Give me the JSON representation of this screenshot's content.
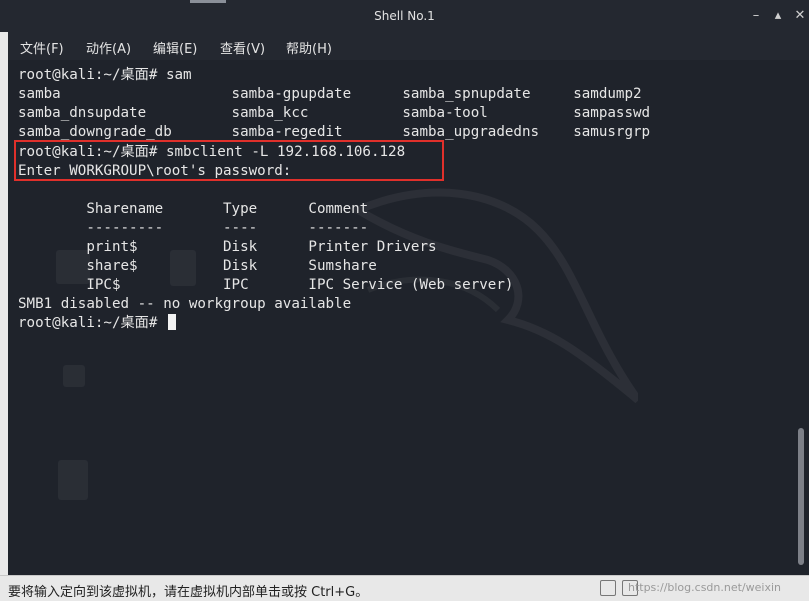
{
  "window": {
    "title": "Shell No.1",
    "controls": [
      "minimize-icon",
      "maximize-icon",
      "close-icon"
    ]
  },
  "menu": {
    "items": [
      "文件(F)",
      "动作(A)",
      "编辑(E)",
      "查看(V)",
      "帮助(H)"
    ]
  },
  "terminal": {
    "lines": [
      "root@kali:~/桌面# sam",
      "samba                    samba-gpupdate      samba_spnupdate     samdump2",
      "samba_dnsupdate          samba_kcc           samba-tool          sampasswd",
      "samba_downgrade_db       samba-regedit       samba_upgradedns    samusrgrp",
      "root@kali:~/桌面# smbclient -L 192.168.106.128",
      "Enter WORKGROUP\\root's password:",
      "",
      "        Sharename       Type      Comment",
      "        ---------       ----      -------",
      "        print$          Disk      Printer Drivers",
      "        share$          Disk      Sumshare",
      "        IPC$            IPC       IPC Service (Web server)",
      "SMB1 disabled -- no workgroup available",
      "root@kali:~/桌面# "
    ]
  },
  "statusbar": {
    "text": "要将输入定向到该虚拟机，请在虚拟机内部单击或按 Ctrl+G。",
    "watermark": "https://blog.csdn.net/weixin"
  },
  "colors": {
    "terminal_bg": "#1f232b",
    "terminal_fg": "#e6e6e6",
    "highlight": "#e0302b"
  }
}
